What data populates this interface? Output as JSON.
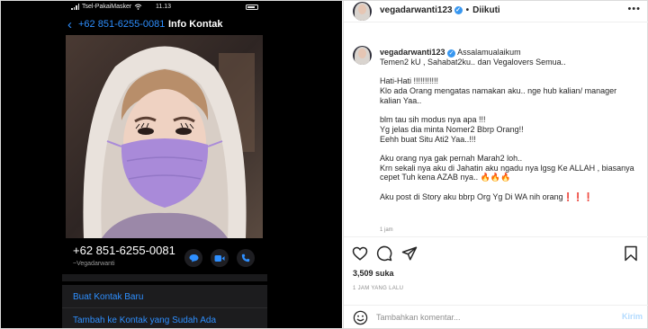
{
  "phone": {
    "carrier": "Tsel-PakaiMasker",
    "time": "11.13",
    "back_number": "+62 851-6255-0081",
    "title": "Info Kontak",
    "contact_number": "+62 851-6255-0081",
    "contact_name": "~Vegadarwanti",
    "menu": [
      "Buat Kontak Baru",
      "Tambah ke Kontak yang Sudah Ada"
    ],
    "mask_color": "#a98ad9",
    "link_color": "#2e8fff"
  },
  "header": {
    "username": "vegadarwanti123",
    "dot": "•",
    "follow_status": "Diikuti",
    "more_icon": "more-icon"
  },
  "caption": {
    "username": "vegadarwanti123",
    "lines": [
      "Assalamualaikum",
      "Temen2 kU , Sahabat2ku.. dan Vegalovers Semua..",
      "",
      "Hati-Hati !!!!!!!!!!!",
      "Klo ada Orang mengatas namakan aku.. nge hub kalian/ manager",
      "kalian Yaa..",
      "",
      "blm tau sih modus nya apa !!!",
      "Yg jelas dia minta Nomer2 Bbrp Orang!!",
      "Eehh buat Situ Ati2 Yaa..!!!",
      "",
      "Aku orang nya gak pernah Marah2 loh..",
      "Krn sekali nya aku di Jahatin aku ngadu nya lgsg Ke ALLAH , biasanya",
      "cepet Tuh kena AZAB nya.. 🔥🔥🔥",
      "",
      "Aku post di Story aku bbrp Org Yg Di WA nih orang❗❗❗"
    ],
    "small_time": "1 jam"
  },
  "actions": [
    "heart-icon",
    "comment-icon",
    "share-icon",
    "bookmark-icon"
  ],
  "likes": "3,509 suka",
  "post_time": "1 JAM YANG LALU",
  "comment": {
    "placeholder": "Tambahkan komentar...",
    "post_label": "Kirim"
  },
  "colors": {
    "verified": "#3897f0",
    "post_button_disabled": "#b3dbff"
  }
}
